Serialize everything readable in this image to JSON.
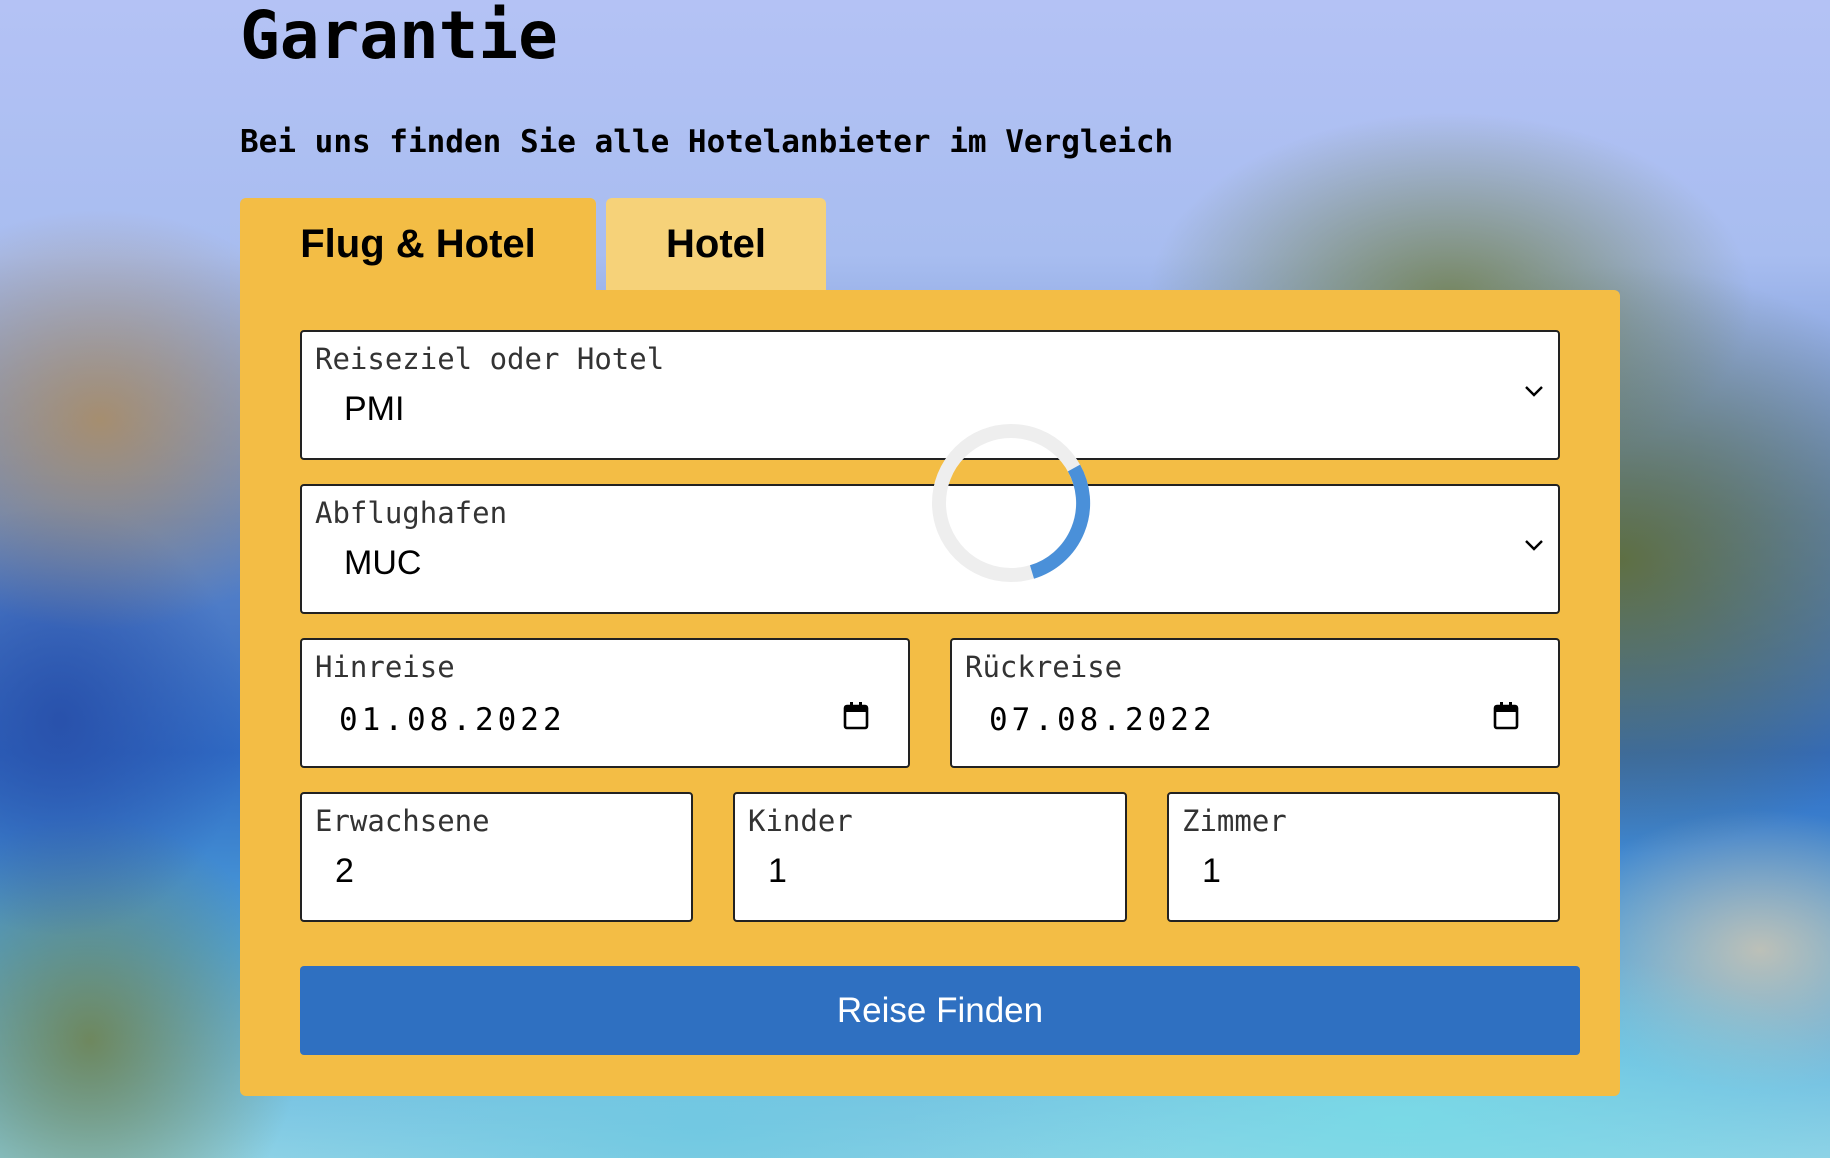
{
  "header": {
    "title": "Garantie",
    "subtitle": "Bei uns finden Sie alle Hotelanbieter im Vergleich"
  },
  "tabs": [
    {
      "label": "Flug & Hotel",
      "active": true
    },
    {
      "label": "Hotel",
      "active": false
    }
  ],
  "form": {
    "destination": {
      "label": "Reiseziel oder Hotel",
      "value": "PMI"
    },
    "departure_airport": {
      "label": "Abflughafen",
      "value": "MUC"
    },
    "outbound": {
      "label": "Hinreise",
      "value": "01.08.2022"
    },
    "return": {
      "label": "Rückreise",
      "value": "07.08.2022"
    },
    "adults": {
      "label": "Erwachsene",
      "value": "2"
    },
    "children": {
      "label": "Kinder",
      "value": "1"
    },
    "rooms": {
      "label": "Zimmer",
      "value": "1"
    },
    "submit_label": "Reise Finden"
  },
  "icons": {
    "dropdown": "chevron-down-icon",
    "date": "calendar-icon",
    "loading": "loading-spinner-icon"
  },
  "colors": {
    "panel": "#f3bd45",
    "tab_inactive": "#f6d279",
    "button": "#2f70c1",
    "spinner_track": "#eeeeee",
    "spinner_arc": "#4a90d9"
  }
}
